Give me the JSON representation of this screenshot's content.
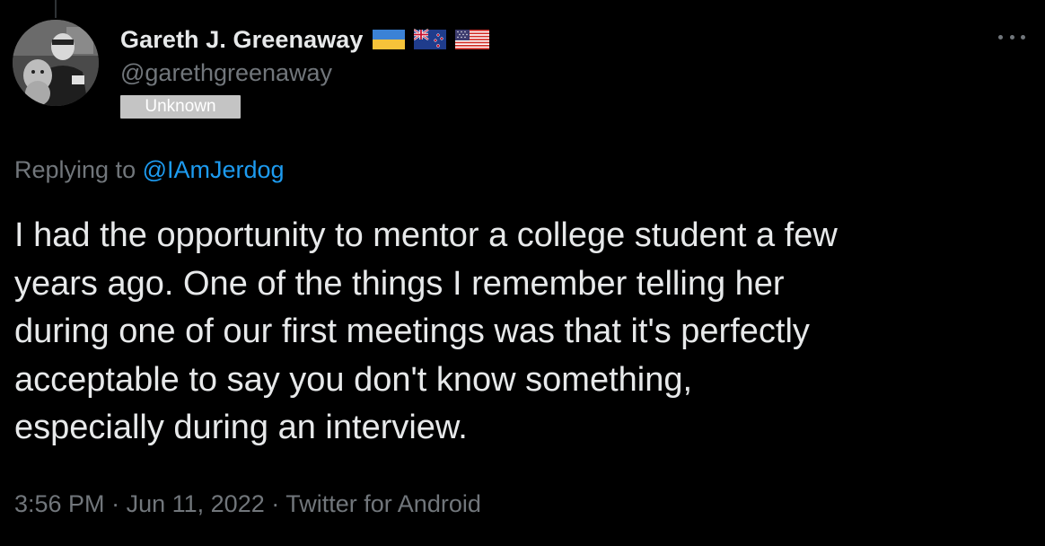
{
  "tweet": {
    "author": {
      "display_name": "Gareth J. Greenaway",
      "handle": "@garethgreenaway",
      "label": "Unknown",
      "flags": [
        "ukraine-flag-icon",
        "new-zealand-flag-icon",
        "usa-flag-icon"
      ]
    },
    "replying_prefix": "Replying to ",
    "replying_to": "@IAmJerdog",
    "text": "I had the opportunity to mentor a college student a few\nyears ago. One of the things I remember telling her\nduring one of our first meetings was that it's perfectly\nacceptable to say you don't know something,\nespecially during an interview.",
    "time": "3:56 PM",
    "separator": "·",
    "date": "Jun 11, 2022",
    "source": "Twitter for Android"
  },
  "colors": {
    "background": "#000000",
    "primary_text": "#e7e9ea",
    "secondary_text": "#71767b",
    "link": "#1d9bf0",
    "badge_bg": "#c4c4c4"
  }
}
